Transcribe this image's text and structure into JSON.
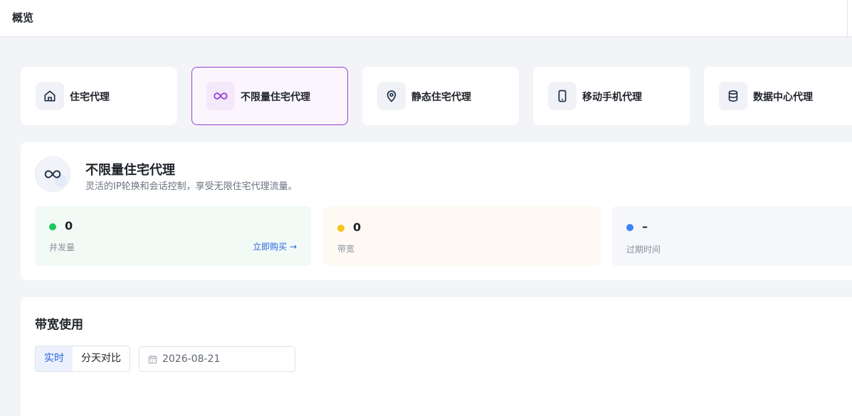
{
  "header": {
    "title": "概览"
  },
  "tiles": [
    {
      "label": "住宅代理",
      "icon": "home-icon",
      "active": false
    },
    {
      "label": "不限量住宅代理",
      "icon": "infinity-icon",
      "active": true
    },
    {
      "label": "静态住宅代理",
      "icon": "location-pin-icon",
      "active": false
    },
    {
      "label": "移动手机代理",
      "icon": "mobile-phone-icon",
      "active": false
    },
    {
      "label": "数据中心代理",
      "icon": "database-icon",
      "active": false
    }
  ],
  "detail": {
    "icon": "infinity-icon",
    "title": "不限量住宅代理",
    "description": "灵活的IP轮换和会话控制，享受无限住宅代理流量。",
    "stats": [
      {
        "value": "0",
        "label": "并发量",
        "dot_color": "#22c55e",
        "bg": "#f1faf5",
        "action": "立即购买 →"
      },
      {
        "value": "0",
        "label": "带宽",
        "dot_color": "#f5c518",
        "bg": "#fefaf3"
      },
      {
        "value": "–",
        "label": "过期时间",
        "dot_color": "#3b82f6",
        "bg": "#f5f7fb"
      }
    ]
  },
  "usage": {
    "title": "带宽使用",
    "modes": [
      {
        "label": "实时",
        "selected": true
      },
      {
        "label": "分天对比",
        "selected": false
      }
    ],
    "date_value": "2026-08-21"
  },
  "colors": {
    "accent": "#9b3fd6",
    "link": "#2a63e0"
  }
}
